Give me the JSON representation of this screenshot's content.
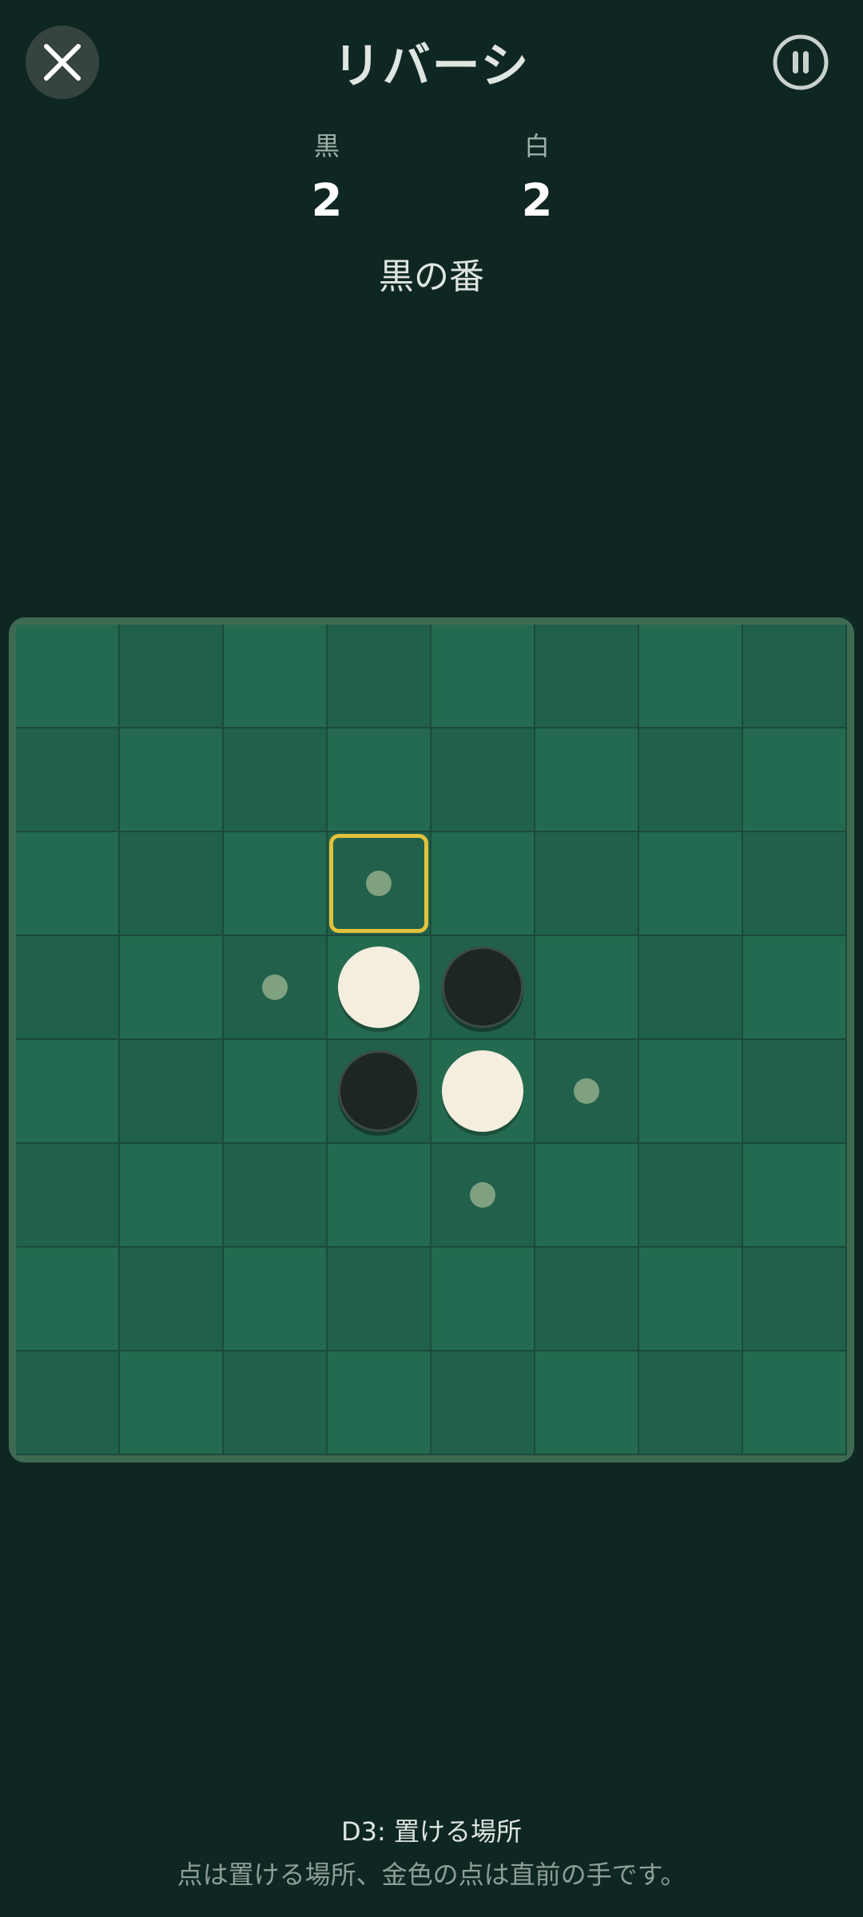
{
  "header": {
    "title": "リバーシ",
    "close_icon": "close-icon",
    "pause_icon": "pause-icon"
  },
  "scores": {
    "black": {
      "label": "黒",
      "value": "2"
    },
    "white": {
      "label": "白",
      "value": "2"
    }
  },
  "turn_text": "黒の番",
  "board": {
    "rows": 8,
    "cols": 8,
    "pieces": [
      {
        "cell": "D4",
        "color": "white"
      },
      {
        "cell": "E4",
        "color": "black"
      },
      {
        "cell": "D5",
        "color": "black"
      },
      {
        "cell": "E5",
        "color": "white"
      }
    ],
    "legal_moves": [
      "D3",
      "C4",
      "F5",
      "E6"
    ],
    "last_move": "D3"
  },
  "footer": {
    "info": "D3: 置ける場所",
    "hint": "点は置ける場所、金色の点は直前の手です。"
  },
  "colors": {
    "background": "#0f2722",
    "board_light": "#246a50",
    "board_dark": "#21604a",
    "highlight": "#e2c23a",
    "hint_dot": "#7fa17f"
  }
}
